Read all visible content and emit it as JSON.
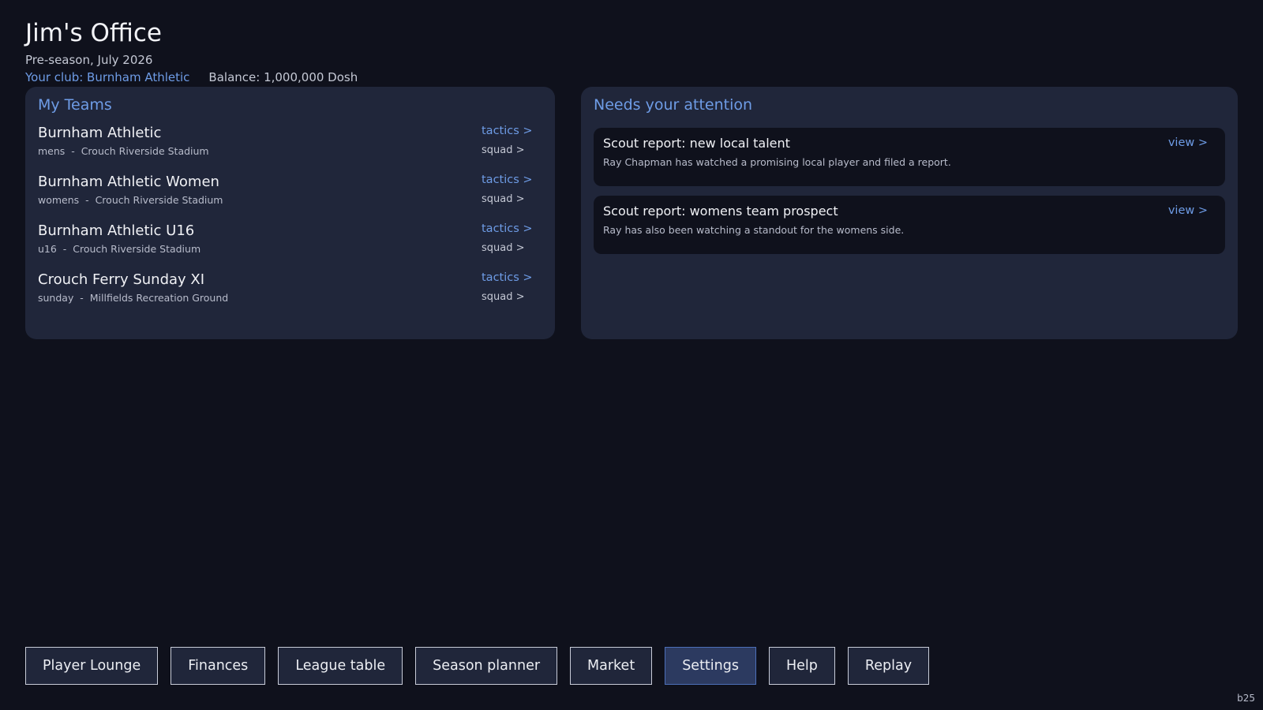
{
  "header": {
    "title": "Jim's Office",
    "subtitle": "Pre-season, July 2026",
    "club": "Your club: Burnham Athletic",
    "balance": "Balance: 1,000,000 Dosh"
  },
  "teams_panel": {
    "title": "My Teams",
    "teams": [
      {
        "name": "Burnham Athletic",
        "meta": "mens  -  Crouch Riverside Stadium",
        "tactics": "tactics >",
        "squad": "squad >"
      },
      {
        "name": "Burnham Athletic Women",
        "meta": "womens  -  Crouch Riverside Stadium",
        "tactics": "tactics >",
        "squad": "squad >"
      },
      {
        "name": "Burnham Athletic U16",
        "meta": "u16  -  Crouch Riverside Stadium",
        "tactics": "tactics >",
        "squad": "squad >"
      },
      {
        "name": "Crouch Ferry Sunday XI",
        "meta": "sunday  -  Millfields Recreation Ground",
        "tactics": "tactics >",
        "squad": "squad >"
      }
    ]
  },
  "attention_panel": {
    "title": "Needs your attention",
    "items": [
      {
        "title": "Scout report: new local talent",
        "desc": "Ray Chapman has watched a promising local player and filed a report.",
        "action": "view >"
      },
      {
        "title": "Scout report: womens team prospect",
        "desc": "Ray has also been watching a standout for the womens side.",
        "action": "view >"
      }
    ]
  },
  "nav": {
    "buttons": [
      "Player Lounge",
      "Finances",
      "League table",
      "Season planner",
      "Market",
      "Settings",
      "Help",
      "Replay"
    ],
    "active": "Settings"
  },
  "build": "b25",
  "colors": {
    "background": "#0f111c",
    "panel": "#20263a",
    "accent": "#6e9ce6",
    "active_button": "#2c3a60"
  }
}
